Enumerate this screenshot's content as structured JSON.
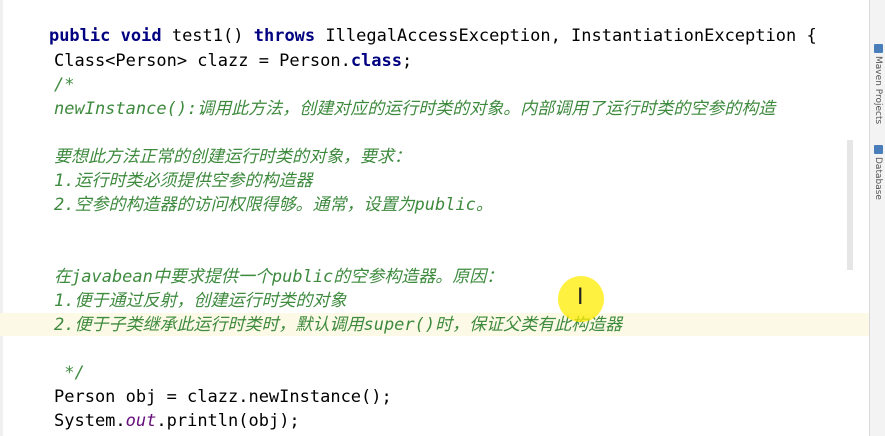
{
  "editor": {
    "lines": [
      {
        "kind": "signature",
        "kw1": "public",
        "kw2": "void",
        "name": "test1()",
        "kw3": "throws",
        "rest": "IllegalAccessException, InstantiationException {"
      },
      {
        "kind": "code",
        "text": "Class<Person> clazz = Person.",
        "kw": "class",
        "tail": ";"
      },
      {
        "kind": "comment",
        "text": "/*"
      },
      {
        "kind": "comment",
        "text": "newInstance():调用此方法，创建对应的运行时类的对象。内部调用了运行时类的空参的构造"
      },
      {
        "kind": "comment",
        "text": "要想此方法正常的创建运行时类的对象，要求："
      },
      {
        "kind": "comment",
        "text": "1.运行时类必须提供空参的构造器"
      },
      {
        "kind": "comment",
        "text": "2.空参的构造器的访问权限得够。通常，设置为public。"
      },
      {
        "kind": "comment",
        "text": "在javabean中要求提供一个public的空参构造器。原因："
      },
      {
        "kind": "comment",
        "text": "1.便于通过反射，创建运行时类的对象"
      },
      {
        "kind": "comment",
        "text": "2.便于子类继承此运行时类时，默认调用super()时，保证父类有此构造器"
      },
      {
        "kind": "comment",
        "text": " */"
      },
      {
        "kind": "code2",
        "text": "Person obj = clazz.newInstance();"
      },
      {
        "kind": "code3",
        "pre": "System.",
        "field": "out",
        "post": ".println(obj);"
      }
    ]
  },
  "side_panel": {
    "tab1": "Maven Projects",
    "tab2": "Database"
  },
  "cursor": {
    "icon": "text-cursor-icon",
    "glyph": "I"
  }
}
